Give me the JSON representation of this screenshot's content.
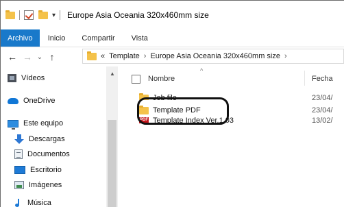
{
  "window": {
    "title": "Europe Asia Oceania 320x460mm size"
  },
  "ribbon": {
    "tabs": [
      "Archivo",
      "Inicio",
      "Compartir",
      "Vista"
    ]
  },
  "address": {
    "overflow": "«",
    "crumbs": [
      "Template",
      "Europe Asia Oceania 320x460mm size"
    ],
    "separator": "›"
  },
  "nav_pane": {
    "items": [
      {
        "label": "Vídeos",
        "icon": "video-icon"
      },
      {
        "label": "OneDrive",
        "icon": "onedrive-icon"
      },
      {
        "label": "Este equipo",
        "icon": "computer-icon"
      },
      {
        "label": "Descargas",
        "icon": "download-icon"
      },
      {
        "label": "Documentos",
        "icon": "documents-icon"
      },
      {
        "label": "Escritorio",
        "icon": "desktop-icon"
      },
      {
        "label": "Imágenes",
        "icon": "images-icon"
      },
      {
        "label": "Música",
        "icon": "music-icon"
      }
    ]
  },
  "content": {
    "columns": {
      "name": "Nombre",
      "date": "Fecha"
    },
    "files": [
      {
        "name": "Job file",
        "date": "23/04/",
        "type": "folder"
      },
      {
        "name": "Template PDF",
        "date": "23/04/",
        "type": "folder"
      },
      {
        "name": "Template Index Ver.1.03",
        "date": "13/02/",
        "type": "pdf"
      }
    ]
  },
  "colors": {
    "file_tab": "#1979ca",
    "folder": "#f4c24a",
    "pdf": "#c4161c"
  }
}
